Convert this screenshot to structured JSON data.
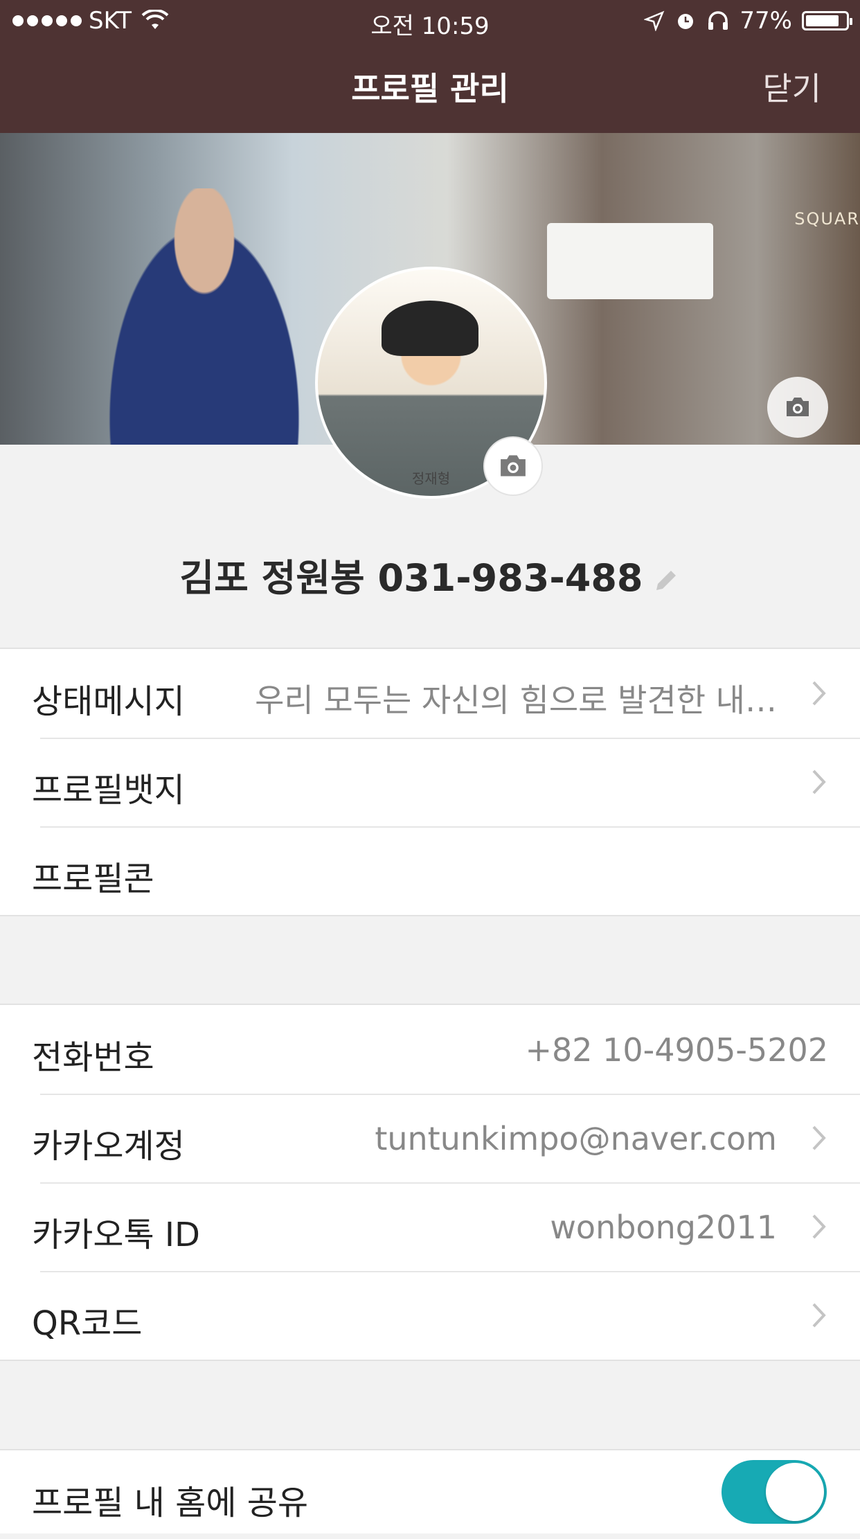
{
  "status_bar": {
    "carrier": "SKT",
    "time": "오전 10:59",
    "battery": "77%",
    "battery_level": 0.77
  },
  "nav": {
    "title": "프로필 관리",
    "close_label": "닫기"
  },
  "cover": {
    "sign_text": "SQUAR",
    "camera_icon": "camera-icon"
  },
  "avatar": {
    "caption": "정재형",
    "camera_icon": "camera-icon"
  },
  "profile": {
    "name": "김포 정원봉 031-983-488",
    "edit_icon": "pencil-icon"
  },
  "group1": {
    "status_message": {
      "label": "상태메시지",
      "value": "우리 모두는 자신의 힘으로 발견한 내…"
    },
    "profile_badge": {
      "label": "프로필뱃지"
    },
    "profilecon": {
      "label": "프로필콘"
    }
  },
  "group2": {
    "phone": {
      "label": "전화번호",
      "value": "+82 10-4905-5202"
    },
    "kakao_account": {
      "label": "카카오계정",
      "value": "tuntunkimpo@naver.com"
    },
    "kakaotalk_id": {
      "label": "카카오톡 ID",
      "value": "wonbong2011"
    },
    "qr_code": {
      "label": "QR코드"
    }
  },
  "group3": {
    "share_home": {
      "label": "프로필 내 홈에 공유",
      "enabled": true
    }
  },
  "colors": {
    "nav_bg": "#4e3333",
    "toggle_on": "#17aab4",
    "page_bg": "#f2f2f2"
  }
}
